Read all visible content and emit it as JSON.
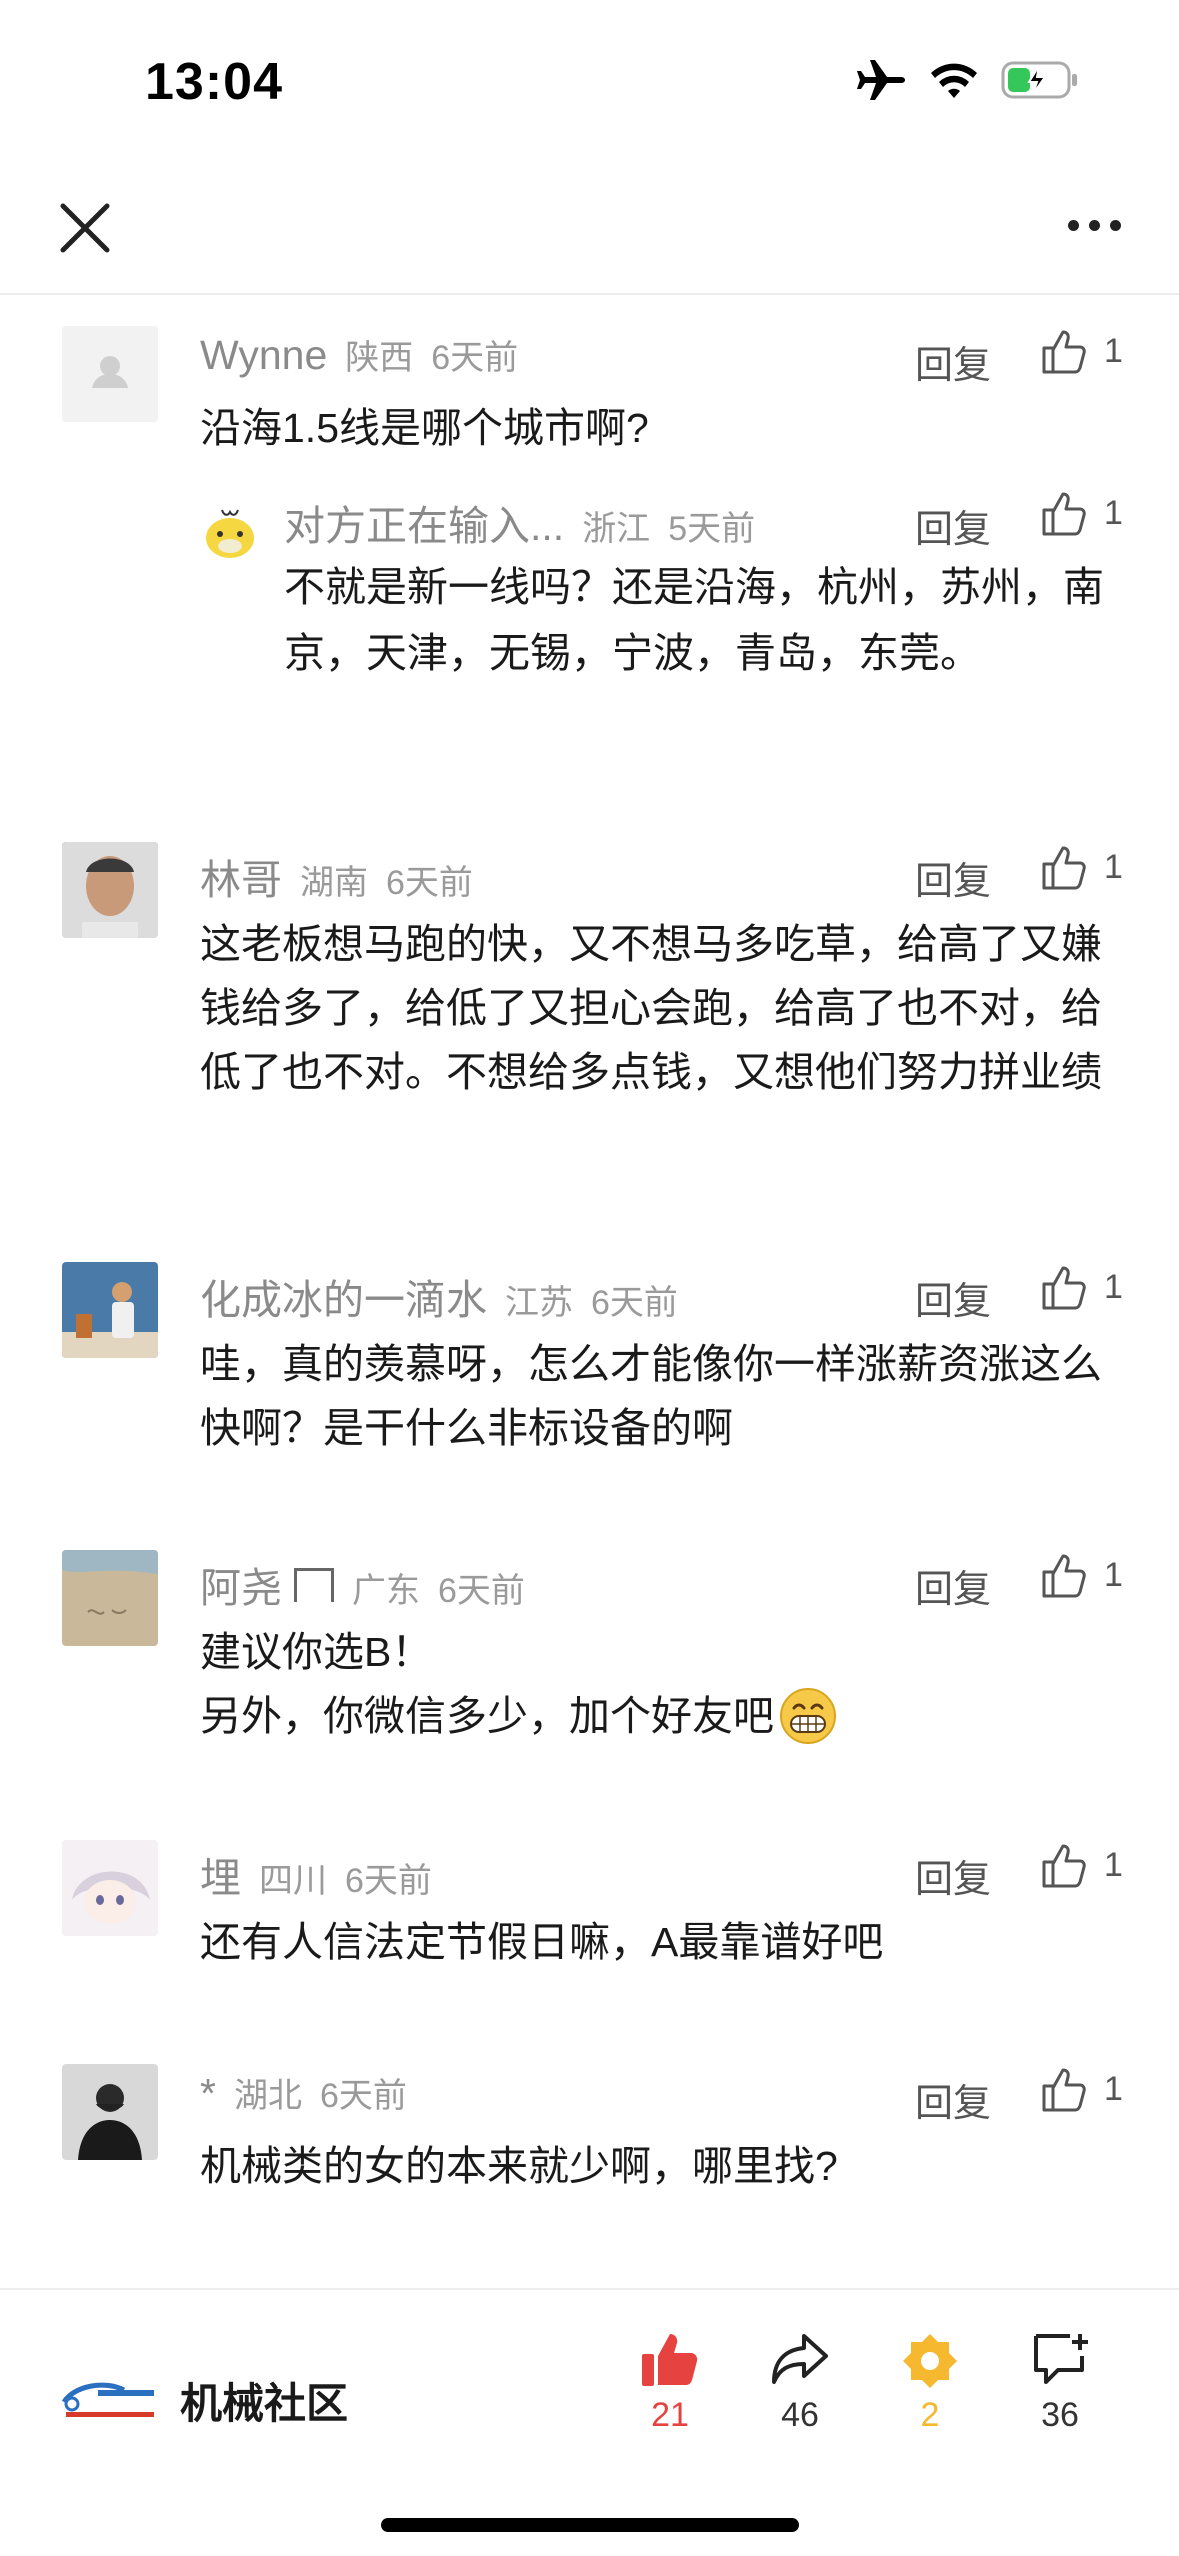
{
  "status": {
    "time": "13:04"
  },
  "comments": [
    {
      "name": "Wynne",
      "region": "陕西",
      "time": "6天前",
      "text": "沿海1.5线是哪个城市啊?",
      "reply": "回复",
      "likes": "1"
    },
    {
      "name": "林哥",
      "region": "湖南",
      "time": "6天前",
      "text": "这老板想马跑的快，又不想马多吃草，给高了又嫌钱给多了，给低了又担心会跑，给高了也不对，给低了也不对。不想给多点钱，又想他们努力拼业绩",
      "reply": "回复",
      "likes": "1"
    },
    {
      "name": "化成冰的一滴水",
      "region": "江苏",
      "time": "6天前",
      "text": "哇，真的羡慕呀，怎么才能像你一样涨薪资涨这么快啊？是干什么非标设备的啊",
      "reply": "回复",
      "likes": "1"
    },
    {
      "name": "阿尧",
      "region": "广东",
      "time": "6天前",
      "text": "建议你选B！",
      "text2": "另外，你微信多少，加个好友吧",
      "reply": "回复",
      "likes": "1"
    },
    {
      "name": "埋",
      "region": "四川",
      "time": "6天前",
      "text": "还有人信法定节假日嘛，A最靠谱好吧",
      "reply": "回复",
      "likes": "1"
    },
    {
      "name": "*",
      "region": "湖北",
      "time": "6天前",
      "text": "机械类的女的本来就少啊，哪里找?",
      "reply": "回复",
      "likes": "1"
    }
  ],
  "sub_reply": {
    "name": "对方正在输入...",
    "region": "浙江",
    "time": "5天前",
    "text": "不就是新一线吗？还是沿海，杭州，苏州，南京，天津，无锡，宁波，青岛，东莞。",
    "reply": "回复",
    "likes": "1"
  },
  "bottom": {
    "brand": "机械社区",
    "likes": "21",
    "shares": "46",
    "favorites": "2",
    "comments": "36",
    "like_color": "#e64340",
    "fav_color": "#f5b82e"
  }
}
